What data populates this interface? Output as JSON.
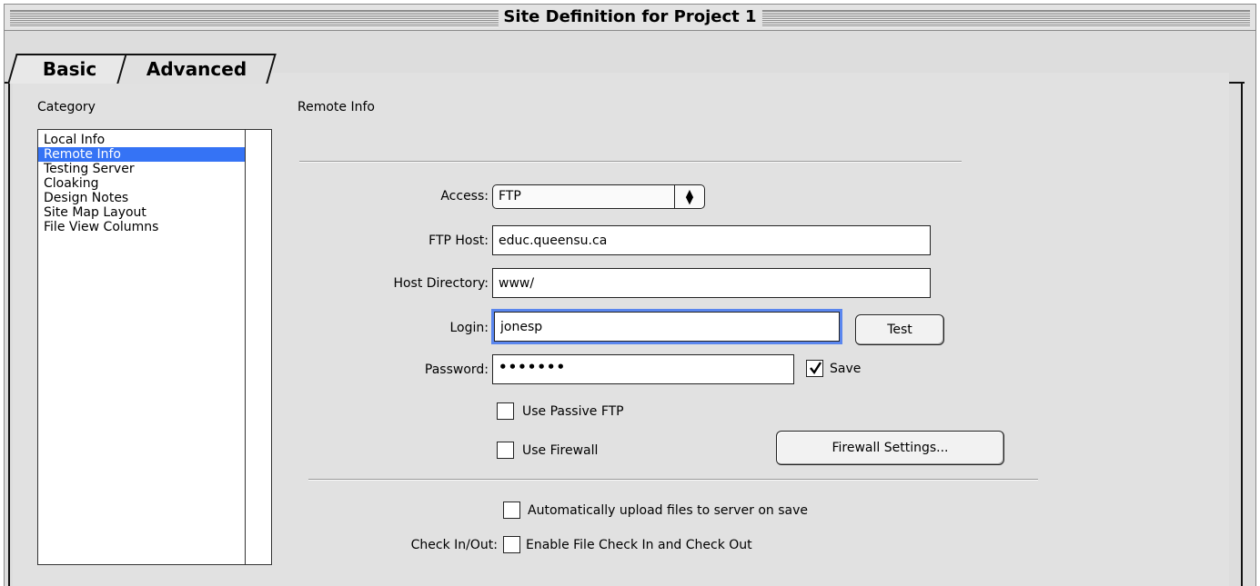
{
  "window": {
    "title": "Site Definition for Project 1"
  },
  "tabs": [
    {
      "label": "Basic",
      "selected": false
    },
    {
      "label": "Advanced",
      "selected": true
    }
  ],
  "category": {
    "heading": "Category",
    "items": [
      "Local Info",
      "Remote Info",
      "Testing Server",
      "Cloaking",
      "Design Notes",
      "Site Map Layout",
      "File View Columns"
    ],
    "selected": "Remote Info"
  },
  "remote": {
    "heading": "Remote Info",
    "access_label": "Access:",
    "access_value": "FTP",
    "ftp_host_label": "FTP Host:",
    "ftp_host_value": "educ.queensu.ca",
    "host_dir_label": "Host Directory:",
    "host_dir_value": "www/",
    "login_label": "Login:",
    "login_value": "jonesp",
    "test_button": "Test",
    "password_label": "Password:",
    "password_value": "•••••••",
    "save_label": "Save",
    "save_checked": true,
    "passive_ftp_label": "Use Passive FTP",
    "passive_ftp_checked": false,
    "firewall_label": "Use Firewall",
    "firewall_checked": false,
    "firewall_settings_button": "Firewall Settings...",
    "auto_upload_label": "Automatically upload files to server on save",
    "auto_upload_checked": false,
    "checkinout_label": "Check In/Out:",
    "enable_checkinout_label": "Enable File Check In and Check Out",
    "enable_checkinout_checked": false
  },
  "colors": {
    "selection": "#3573f5",
    "focus_ring": "#5a86ee",
    "panel": "#e1e1e1"
  }
}
